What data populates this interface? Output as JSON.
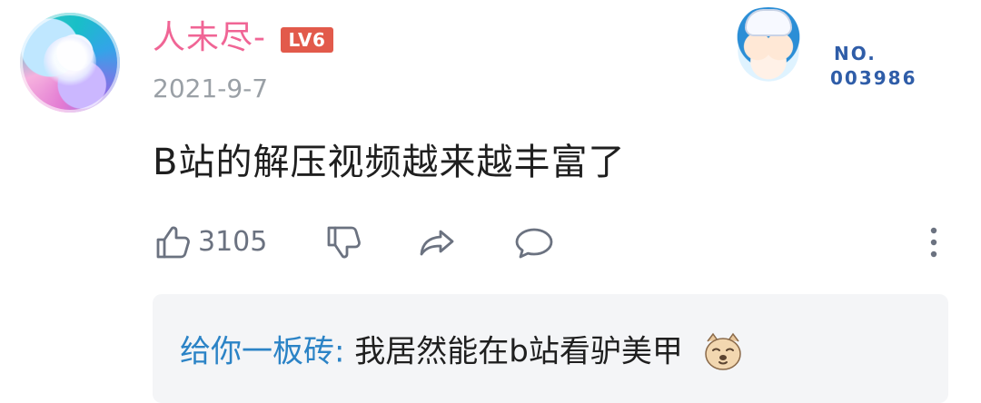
{
  "comment": {
    "username": "人未尽-",
    "level": "LV6",
    "date": "2021-9-7",
    "text": "B站的解压视频越来越丰富了",
    "likes": "3105"
  },
  "fan_badge": {
    "label": "NO.",
    "number": "003986"
  },
  "reply_preview": {
    "author": "给你一板砖",
    "separator": ":",
    "text": " 我居然能在b站看驴美甲",
    "emoji": "dog-face-emoji"
  },
  "icons": {
    "like": "thumbs-up-icon",
    "dislike": "thumbs-down-icon",
    "share": "share-icon",
    "reply": "comment-icon",
    "more": "more-vertical-icon"
  },
  "colors": {
    "username": "#f06595",
    "level_badge": "#e25a4b",
    "meta": "#9aa0a6",
    "text": "#1f1f1f",
    "action_icons": "#6b7280",
    "reply_author": "#2b83c6",
    "reply_bg": "#f4f5f7"
  }
}
